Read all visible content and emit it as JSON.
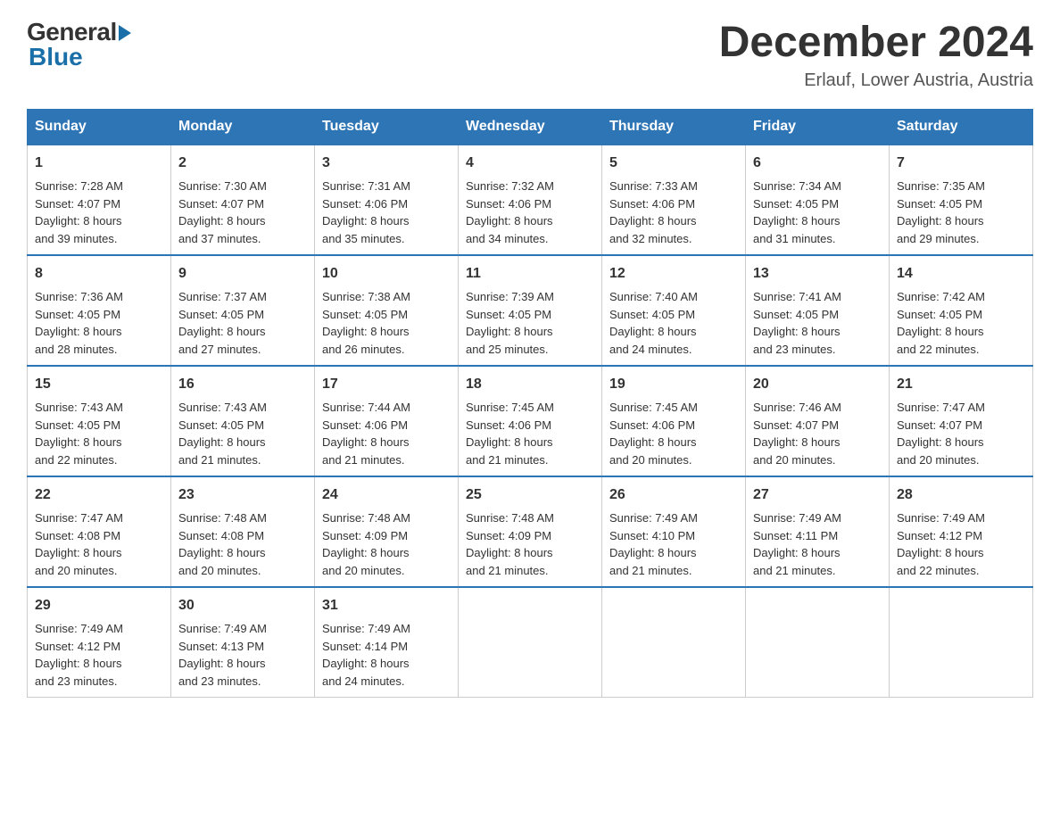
{
  "header": {
    "logo_general": "General",
    "logo_blue": "Blue",
    "month_title": "December 2024",
    "location": "Erlauf, Lower Austria, Austria"
  },
  "days_of_week": [
    "Sunday",
    "Monday",
    "Tuesday",
    "Wednesday",
    "Thursday",
    "Friday",
    "Saturday"
  ],
  "weeks": [
    [
      {
        "day": "1",
        "sunrise": "7:28 AM",
        "sunset": "4:07 PM",
        "daylight": "8 hours and 39 minutes."
      },
      {
        "day": "2",
        "sunrise": "7:30 AM",
        "sunset": "4:07 PM",
        "daylight": "8 hours and 37 minutes."
      },
      {
        "day": "3",
        "sunrise": "7:31 AM",
        "sunset": "4:06 PM",
        "daylight": "8 hours and 35 minutes."
      },
      {
        "day": "4",
        "sunrise": "7:32 AM",
        "sunset": "4:06 PM",
        "daylight": "8 hours and 34 minutes."
      },
      {
        "day": "5",
        "sunrise": "7:33 AM",
        "sunset": "4:06 PM",
        "daylight": "8 hours and 32 minutes."
      },
      {
        "day": "6",
        "sunrise": "7:34 AM",
        "sunset": "4:05 PM",
        "daylight": "8 hours and 31 minutes."
      },
      {
        "day": "7",
        "sunrise": "7:35 AM",
        "sunset": "4:05 PM",
        "daylight": "8 hours and 29 minutes."
      }
    ],
    [
      {
        "day": "8",
        "sunrise": "7:36 AM",
        "sunset": "4:05 PM",
        "daylight": "8 hours and 28 minutes."
      },
      {
        "day": "9",
        "sunrise": "7:37 AM",
        "sunset": "4:05 PM",
        "daylight": "8 hours and 27 minutes."
      },
      {
        "day": "10",
        "sunrise": "7:38 AM",
        "sunset": "4:05 PM",
        "daylight": "8 hours and 26 minutes."
      },
      {
        "day": "11",
        "sunrise": "7:39 AM",
        "sunset": "4:05 PM",
        "daylight": "8 hours and 25 minutes."
      },
      {
        "day": "12",
        "sunrise": "7:40 AM",
        "sunset": "4:05 PM",
        "daylight": "8 hours and 24 minutes."
      },
      {
        "day": "13",
        "sunrise": "7:41 AM",
        "sunset": "4:05 PM",
        "daylight": "8 hours and 23 minutes."
      },
      {
        "day": "14",
        "sunrise": "7:42 AM",
        "sunset": "4:05 PM",
        "daylight": "8 hours and 22 minutes."
      }
    ],
    [
      {
        "day": "15",
        "sunrise": "7:43 AM",
        "sunset": "4:05 PM",
        "daylight": "8 hours and 22 minutes."
      },
      {
        "day": "16",
        "sunrise": "7:43 AM",
        "sunset": "4:05 PM",
        "daylight": "8 hours and 21 minutes."
      },
      {
        "day": "17",
        "sunrise": "7:44 AM",
        "sunset": "4:06 PM",
        "daylight": "8 hours and 21 minutes."
      },
      {
        "day": "18",
        "sunrise": "7:45 AM",
        "sunset": "4:06 PM",
        "daylight": "8 hours and 21 minutes."
      },
      {
        "day": "19",
        "sunrise": "7:45 AM",
        "sunset": "4:06 PM",
        "daylight": "8 hours and 20 minutes."
      },
      {
        "day": "20",
        "sunrise": "7:46 AM",
        "sunset": "4:07 PM",
        "daylight": "8 hours and 20 minutes."
      },
      {
        "day": "21",
        "sunrise": "7:47 AM",
        "sunset": "4:07 PM",
        "daylight": "8 hours and 20 minutes."
      }
    ],
    [
      {
        "day": "22",
        "sunrise": "7:47 AM",
        "sunset": "4:08 PM",
        "daylight": "8 hours and 20 minutes."
      },
      {
        "day": "23",
        "sunrise": "7:48 AM",
        "sunset": "4:08 PM",
        "daylight": "8 hours and 20 minutes."
      },
      {
        "day": "24",
        "sunrise": "7:48 AM",
        "sunset": "4:09 PM",
        "daylight": "8 hours and 20 minutes."
      },
      {
        "day": "25",
        "sunrise": "7:48 AM",
        "sunset": "4:09 PM",
        "daylight": "8 hours and 21 minutes."
      },
      {
        "day": "26",
        "sunrise": "7:49 AM",
        "sunset": "4:10 PM",
        "daylight": "8 hours and 21 minutes."
      },
      {
        "day": "27",
        "sunrise": "7:49 AM",
        "sunset": "4:11 PM",
        "daylight": "8 hours and 21 minutes."
      },
      {
        "day": "28",
        "sunrise": "7:49 AM",
        "sunset": "4:12 PM",
        "daylight": "8 hours and 22 minutes."
      }
    ],
    [
      {
        "day": "29",
        "sunrise": "7:49 AM",
        "sunset": "4:12 PM",
        "daylight": "8 hours and 23 minutes."
      },
      {
        "day": "30",
        "sunrise": "7:49 AM",
        "sunset": "4:13 PM",
        "daylight": "8 hours and 23 minutes."
      },
      {
        "day": "31",
        "sunrise": "7:49 AM",
        "sunset": "4:14 PM",
        "daylight": "8 hours and 24 minutes."
      },
      null,
      null,
      null,
      null
    ]
  ],
  "labels": {
    "sunrise": "Sunrise:",
    "sunset": "Sunset:",
    "daylight": "Daylight:"
  }
}
